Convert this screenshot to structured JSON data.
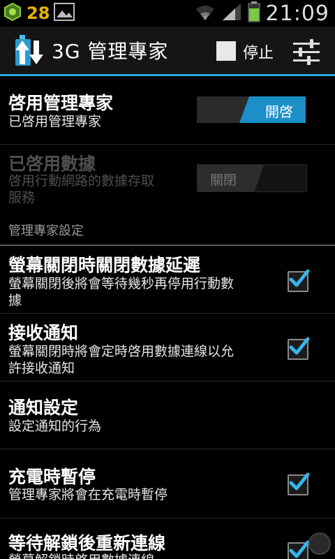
{
  "status_bar": {
    "notification_count": "28",
    "time": "21:09"
  },
  "action_bar": {
    "title": "3G  管理專家",
    "stop_label": "停止"
  },
  "settings": {
    "enable_manager": {
      "title": "啓用管理專家",
      "summary": "已啓用管理專家",
      "toggle_label": "開啓"
    },
    "data_enabled": {
      "title": "已啓用數據",
      "summary_line1": "啓用行動網路的數據存取",
      "summary_line2": "服務",
      "toggle_label": "關閉"
    },
    "category_label": "管理專家設定",
    "items": [
      {
        "title": "螢幕關閉時關閉數據延遲",
        "summary_line1": "螢幕關閉後將會等待幾秒再停用行動數",
        "summary_line2": "據",
        "checked": true
      },
      {
        "title": "接收通知",
        "summary_line1": "螢幕關閉時將會定時啓用數據連線以允",
        "summary_line2": "許接收通知",
        "checked": true
      },
      {
        "title": "通知設定",
        "summary_line1": "設定通知的行為"
      },
      {
        "title": "充電時暫停",
        "summary_line1": "管理專家將會在充電時暫停",
        "checked": true
      },
      {
        "title": "等待解鎖後重新連線",
        "summary_line1": "螢幕解鎖時啓用數據連線",
        "checked": true
      }
    ]
  }
}
